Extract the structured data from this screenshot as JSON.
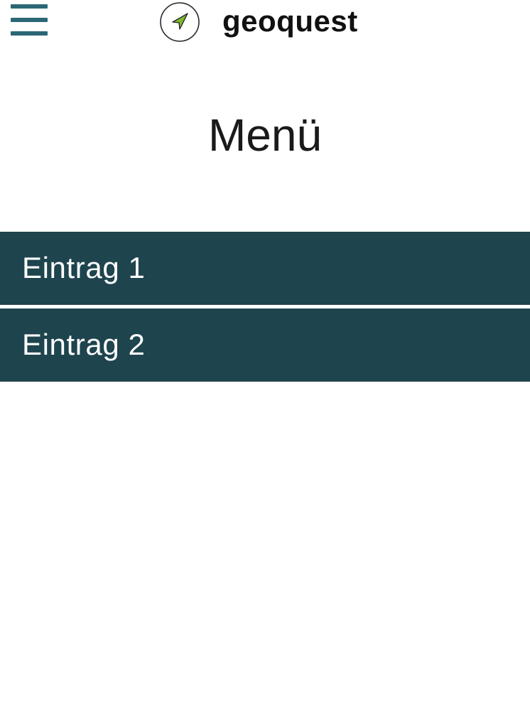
{
  "header": {
    "menu_icon": "hamburger-menu-icon",
    "logo_icon": "navigation-arrow-icon",
    "brand_name": "geoquest"
  },
  "main": {
    "title": "Menü",
    "items": [
      {
        "label": "Eintrag 1"
      },
      {
        "label": "Eintrag 2"
      }
    ]
  },
  "colors": {
    "accent": "#1e444e",
    "hamburger": "#2b6775",
    "logo_arrow": "#7cb82f",
    "text_on_accent": "#ffffff"
  }
}
